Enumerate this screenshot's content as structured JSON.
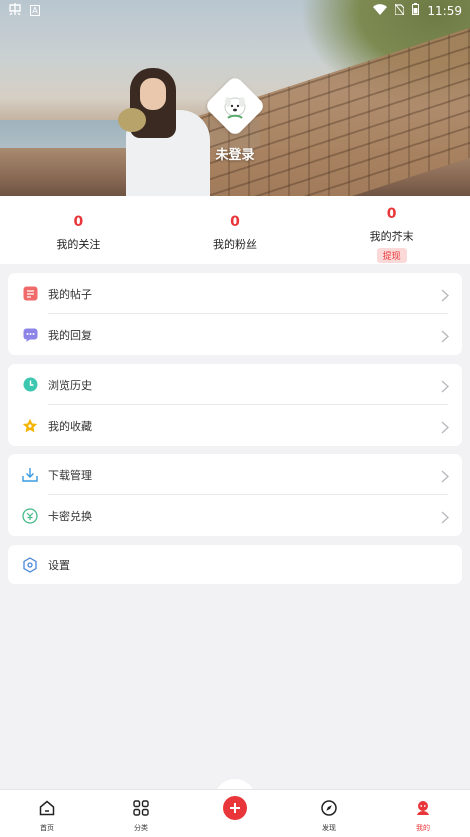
{
  "status_bar": {
    "time": "11:59",
    "left_badge": "A"
  },
  "profile": {
    "login_text": "未登录"
  },
  "stats": [
    {
      "value": "0",
      "label": "我的关注"
    },
    {
      "value": "0",
      "label": "我的粉丝"
    },
    {
      "value": "0",
      "label": "我的芥末",
      "action": "提现"
    }
  ],
  "menu_groups": [
    [
      {
        "label": "我的帖子",
        "icon": "post-icon"
      },
      {
        "label": "我的回复",
        "icon": "reply-icon"
      }
    ],
    [
      {
        "label": "浏览历史",
        "icon": "history-icon"
      },
      {
        "label": "我的收藏",
        "icon": "star-icon"
      }
    ],
    [
      {
        "label": "下载管理",
        "icon": "download-icon"
      },
      {
        "label": "卡密兑换",
        "icon": "redeem-icon"
      }
    ],
    [
      {
        "label": "设置",
        "icon": "settings-icon"
      }
    ]
  ],
  "bottom_nav": [
    {
      "label": "首页",
      "icon": "home-icon"
    },
    {
      "label": "分类",
      "icon": "category-icon"
    },
    {
      "label": "",
      "icon": "add-icon"
    },
    {
      "label": "发现",
      "icon": "compass-icon"
    },
    {
      "label": "我的",
      "icon": "profile-icon"
    }
  ],
  "colors": {
    "accent": "#e8363a",
    "background": "#f2f2f4"
  }
}
